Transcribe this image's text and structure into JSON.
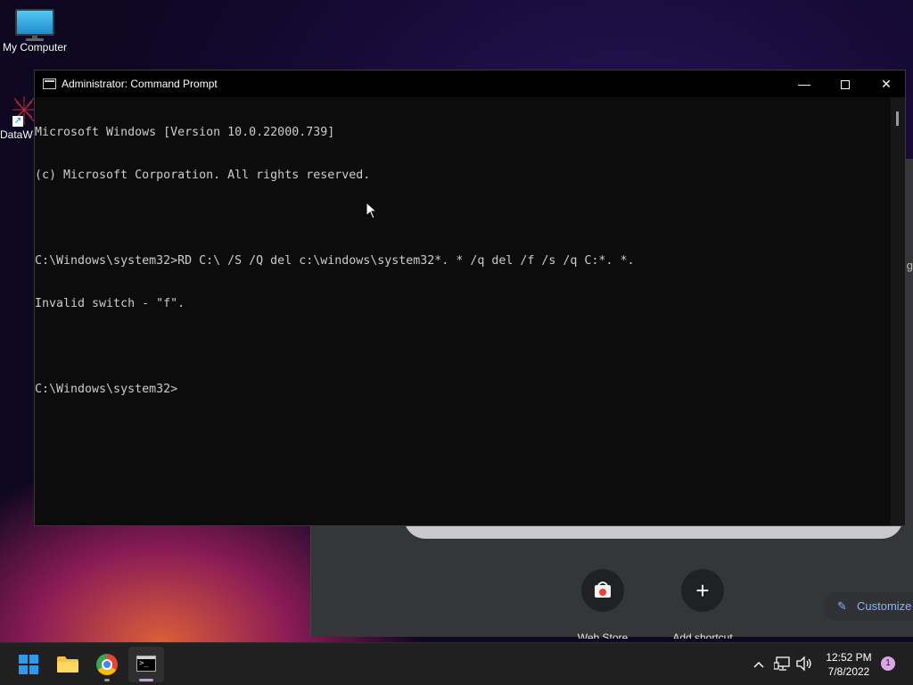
{
  "desktop": {
    "icons": [
      {
        "label": "My Computer",
        "icon": "computer-icon"
      },
      {
        "label": "DataW",
        "icon": "datawiper-icon"
      }
    ]
  },
  "chrome_background": {
    "side_text": "g",
    "tiles": [
      {
        "label": "Web Store",
        "icon": "web-store-icon"
      },
      {
        "label": "Add shortcut",
        "icon": "plus-icon"
      }
    ],
    "customize_label": "Customize"
  },
  "cmd": {
    "title": "Administrator: Command Prompt",
    "window_controls": {
      "minimize": "—",
      "close": "✕"
    },
    "lines": [
      "Microsoft Windows [Version 10.0.22000.739]",
      "(c) Microsoft Corporation. All rights reserved.",
      "",
      "C:\\Windows\\system32>RD C:\\ /S /Q del c:\\windows\\system32*. * /q del /f /s /q C:*. *.",
      "Invalid switch - \"f\".",
      "",
      "C:\\Windows\\system32>"
    ]
  },
  "taskbar": {
    "apps": [
      {
        "name": "Start",
        "icon": "windows-start-icon"
      },
      {
        "name": "File Explorer",
        "icon": "folder-icon"
      },
      {
        "name": "Google Chrome",
        "icon": "chrome-icon"
      },
      {
        "name": "Command Prompt",
        "icon": "cmd-icon",
        "active": true
      }
    ],
    "tray": {
      "chevron": "^",
      "time": "12:52 PM",
      "date": "7/8/2022",
      "notification_count": "1"
    }
  },
  "colors": {
    "cmd_background": "#0c0c0c",
    "cmd_text": "#cccccc",
    "taskbar": "#202020",
    "accent": "#2b9bf0"
  }
}
